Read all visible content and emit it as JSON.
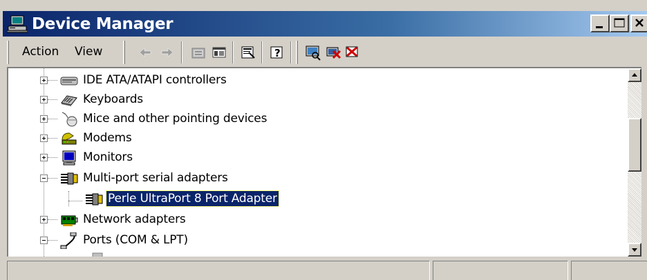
{
  "window": {
    "title": "Device Manager"
  },
  "titlebar_buttons": [
    "minimize",
    "maximize",
    "close"
  ],
  "menu": {
    "action": "Action",
    "view": "View"
  },
  "toolbar": [
    "back-arrow-icon",
    "forward-arrow-icon",
    "up-folder-icon",
    "show-hide-tree-icon",
    "properties-icon",
    "help-icon",
    "scan-hardware-icon",
    "uninstall-icon",
    "disable-icon"
  ],
  "tree": {
    "items": [
      {
        "label": "IDE ATA/ATAPI controllers",
        "icon": "ide-controller-icon",
        "expanded": false
      },
      {
        "label": "Keyboards",
        "icon": "keyboard-icon",
        "expanded": false
      },
      {
        "label": "Mice and other pointing devices",
        "icon": "mouse-icon",
        "expanded": false
      },
      {
        "label": "Modems",
        "icon": "modem-icon",
        "expanded": false
      },
      {
        "label": "Monitors",
        "icon": "monitor-icon",
        "expanded": false
      },
      {
        "label": "Multi-port serial adapters",
        "icon": "serial-adapter-icon",
        "expanded": true
      },
      {
        "label": "Perle UltraPort 8 Port Adapter",
        "icon": "serial-adapter-icon",
        "child": true,
        "selected": true
      },
      {
        "label": "Network adapters",
        "icon": "network-adapter-icon",
        "expanded": false
      },
      {
        "label": "Ports (COM & LPT)",
        "icon": "port-icon",
        "expanded": true
      }
    ]
  },
  "colors": {
    "titlebar_start": "#0a246a",
    "titlebar_end": "#a6caf0",
    "selection": "#0a246a",
    "face": "#d4d0c8"
  }
}
